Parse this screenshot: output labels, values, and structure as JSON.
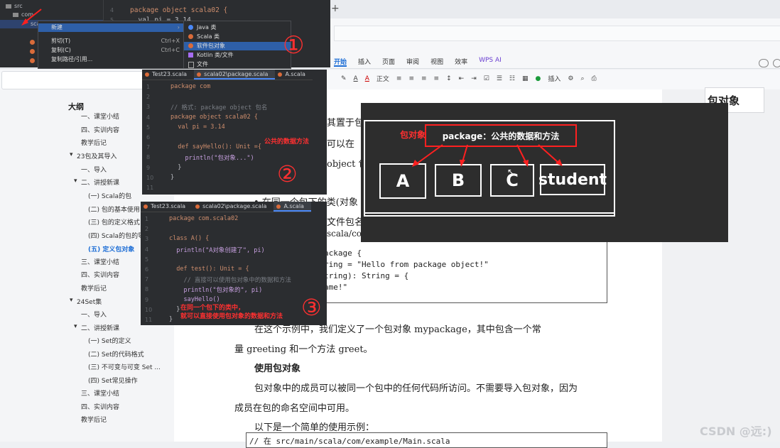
{
  "tabbar": {
    "plus": "+"
  },
  "menu": [
    "开始",
    "插入",
    "页面",
    "审阅",
    "视图",
    "效率",
    "WPS AI"
  ],
  "toolbar": {
    "style": "正文",
    "insert": "插入"
  },
  "outline": {
    "title": "大纲",
    "items": [
      {
        "label": "一、课堂小结",
        "level": 1
      },
      {
        "label": "四、实训内容",
        "level": 1
      },
      {
        "label": "教学后记",
        "level": 1
      },
      {
        "label": "23包及其导入",
        "level": 0
      },
      {
        "label": "一、导入",
        "level": 1
      },
      {
        "label": "二、讲授新课",
        "level": 1
      },
      {
        "label": "(一) Scala的包",
        "level": 2
      },
      {
        "label": "(二) 包的基本使用",
        "level": 2
      },
      {
        "label": "(三) 包的定义格式",
        "level": 2
      },
      {
        "label": "(四) Scala的包的导入",
        "level": 2
      },
      {
        "label": "(五) 定义包对象",
        "level": 2,
        "active": true
      },
      {
        "label": "三、课堂小结",
        "level": 1
      },
      {
        "label": "四、实训内容",
        "level": 1
      },
      {
        "label": "教学后记",
        "level": 1
      },
      {
        "label": "24Set集",
        "level": 0
      },
      {
        "label": "一、导入",
        "level": 1
      },
      {
        "label": "二、讲授新课",
        "level": 1
      },
      {
        "label": "(一) Set的定义",
        "level": 2
      },
      {
        "label": "(二) Set的代码格式",
        "level": 2
      },
      {
        "label": "(三) 不可变与可变 Set ...",
        "level": 2
      },
      {
        "label": "(四) Set常见操作",
        "level": 2
      },
      {
        "label": "三、课堂小结",
        "level": 1
      },
      {
        "label": "四、实训内容",
        "level": 1
      },
      {
        "label": "教学后记",
        "level": 1
      }
    ]
  },
  "doc": {
    "p1": "其置于包",
    "p2": "可以在",
    "p3": "object 包",
    "bullet": "• 在同一个包下的类(对象",
    "p4": "文件包名。所",
    "p5": "scala/com/",
    "code1": [
      "ackage {",
      "ring = \"Hello from package object!\"",
      "tring): String = {",
      "ame!\""
    ],
    "para1": "在这个示例中，我们定义了一个包对象 mypackage，其中包含一个常",
    "para2": "量 greeting 和一个方法 greet。",
    "heading": "使用包对象",
    "para3": "包对象中的成员可以被同一个包中的任何代码所访问。不需要导入包对象，因为",
    "para4": "成员在包的命名空间中可用。",
    "para5": "以下是一个简单的使用示例：",
    "code2": "// 在 src/main/scala/com/example/Main.scala"
  },
  "right_card": "包对象",
  "watermark": "CSDN @远:)",
  "ide1": {
    "tree": [
      "src",
      "com",
      "sca"
    ],
    "code": [
      "package object scala02 {",
      "  val pi = 3.14"
    ],
    "menu": [
      {
        "label": "新建",
        "hl": true,
        "arrow": "›"
      },
      {
        "label": "剪切(T)",
        "short": "Ctrl+X"
      },
      {
        "label": "复制(C)",
        "short": "Ctrl+C"
      },
      {
        "label": "复制路径/引用..."
      }
    ],
    "submenu": [
      "Java 类",
      "Scala 类",
      "软件包对象",
      "Kotlin 类/文件",
      "文件"
    ],
    "annot": "①"
  },
  "ide2": {
    "tabs": [
      "Test23.scala",
      "scala02\\package.scala",
      "A.scala"
    ],
    "lines": [
      "package com",
      "",
      "// 格式: package object 包名",
      "package object scala02 {",
      "  val pi = 3.14",
      "",
      "  def sayHello(): Unit ={",
      "    println(\"包对象...\")",
      "  }",
      "}",
      ""
    ],
    "note": "公共的数据方法",
    "annot": "②"
  },
  "ide3": {
    "tabs": [
      "Test23.scala",
      "scala02\\package.scala",
      "A.scala"
    ],
    "lines": [
      "package com.scala02",
      "",
      "class A() {",
      "  println(\"A对象创建了\", pi)",
      "",
      "  def test(): Unit = {",
      "    // 直接可以使用包对象中的数据和方法",
      "    println(\"包对象的\", pi)",
      "    sayHello()",
      "  }",
      "}"
    ],
    "note1": "在同一个包下的类中，",
    "note2": "就可以直接使用包对象的数据和方法",
    "annot": "③"
  },
  "diagram": {
    "label": "包对象",
    "title": "package：公共的数据和方法",
    "boxes": [
      "A",
      "B",
      "C",
      "student"
    ]
  }
}
